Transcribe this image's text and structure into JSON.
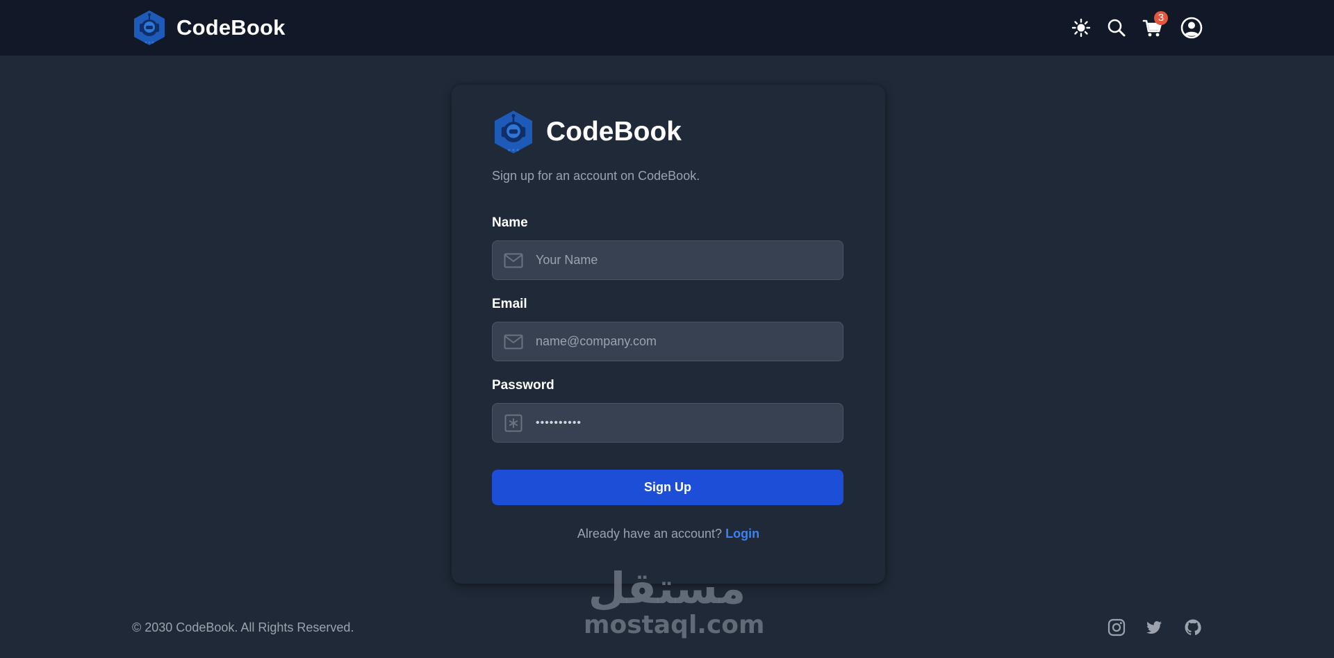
{
  "header": {
    "brand_name": "CodeBook",
    "cart_count": "3",
    "icons": [
      "sun-icon",
      "search-icon",
      "cart-icon",
      "user-circle-icon"
    ]
  },
  "form": {
    "brand_name": "CodeBook",
    "subtitle": "Sign up for an account on CodeBook.",
    "fields": [
      {
        "label": "Name",
        "placeholder": "Your Name",
        "value": "",
        "icon": "envelope-icon"
      },
      {
        "label": "Email",
        "placeholder": "name@company.com",
        "value": "",
        "icon": "envelope-icon"
      },
      {
        "label": "Password",
        "placeholder": "",
        "value": "••••••••••",
        "icon": "asterisk-icon"
      }
    ],
    "submit_label": "Sign Up",
    "login_prompt": "Already have an account?",
    "login_link": "Login"
  },
  "footer": {
    "copyright": "© 2030 CodeBook. All Rights Reserved.",
    "social_icons": [
      "instagram-icon",
      "twitter-icon",
      "github-icon"
    ]
  },
  "watermark": {
    "arabic": "مستقل",
    "latin": "mostaql.com"
  },
  "colors": {
    "page_bg": "#1f2937",
    "header_bg": "#111827",
    "input_bg": "#374151",
    "primary": "#1d4ed8",
    "link": "#3b82f6",
    "badge": "#e4573d",
    "logo_blue": "#1e5bb8"
  }
}
